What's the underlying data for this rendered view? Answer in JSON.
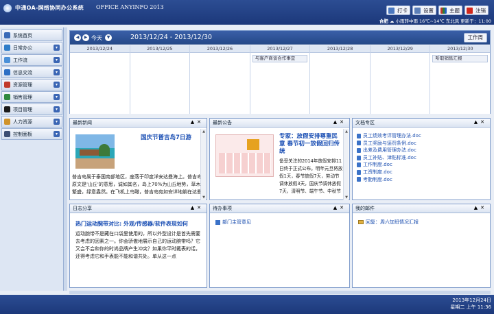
{
  "app": {
    "title": "中通OA-网络协同办公系统",
    "subtitle": "OFFICE ANYINFO 2013"
  },
  "toolbar": {
    "buttons": [
      {
        "label": "打卡",
        "icon": "clock-icon",
        "color": "#4b78c0"
      },
      {
        "label": "设置",
        "icon": "gear-icon",
        "color": "#5c7fb8"
      },
      {
        "label": "主题",
        "icon": "theme-icon",
        "color": "#c0392b"
      },
      {
        "label": "注销",
        "icon": "logout-icon",
        "color": "#d0281c"
      }
    ]
  },
  "weather": {
    "city": "合肥",
    "text": "小雨转中雨 16℃~14℃ 东北风 更新于：11:00"
  },
  "sidebar": {
    "items": [
      {
        "label": "系统首页",
        "icon": "home-icon",
        "color": "#3a6bb8",
        "has_menu": false
      },
      {
        "label": "日常办公",
        "icon": "calendar-icon",
        "color": "#2e7dc9",
        "has_menu": true
      },
      {
        "label": "工作流",
        "icon": "workflow-icon",
        "color": "#4a90d8",
        "has_menu": true
      },
      {
        "label": "信息交流",
        "icon": "chat-icon",
        "color": "#2c6fc4",
        "has_menu": true
      },
      {
        "label": "资源管理",
        "icon": "folder-icon",
        "color": "#c13a2b",
        "has_menu": true
      },
      {
        "label": "销售管理",
        "icon": "sales-icon",
        "color": "#2f8a3f",
        "has_menu": true
      },
      {
        "label": "项目管理",
        "icon": "project-icon",
        "color": "#1b1b1b",
        "has_menu": true
      },
      {
        "label": "人力资源",
        "icon": "people-icon",
        "color": "#d0932a",
        "has_menu": true
      },
      {
        "label": "控制面板",
        "icon": "control-panel-icon",
        "color": "#3d4f73",
        "has_menu": true
      }
    ]
  },
  "calendar": {
    "today_label": "今天",
    "range": "2013/12/24 - 2013/12/30",
    "view_button": "工作周",
    "days": [
      {
        "date": "2013/12/24",
        "event": ""
      },
      {
        "date": "2013/12/25",
        "event": ""
      },
      {
        "date": "2013/12/26",
        "event": ""
      },
      {
        "date": "2013/12/27",
        "event": "与客户商谈合作事宜"
      },
      {
        "date": "2013/12/28",
        "event": ""
      },
      {
        "date": "2013/12/29",
        "event": ""
      },
      {
        "date": "2013/12/30",
        "event": "听取销售汇报"
      }
    ]
  },
  "panels": {
    "news": {
      "title": "最新新闻",
      "headline": "国庆节普吉岛7日游",
      "body": "普吉岛属于泰国南部地区，座落于印度洋安达曼海上。普吉岛原文是'山丘'的意思，诚如其名，岛上70%为山丘地势，草木繁盛，绿意盎然。在飞机上鸟瞰，普吉岛宛如安详地躺在达曼海上的一颗'绿色珍珠'，全岛南北纵..."
    },
    "notice": {
      "title": "最新公告",
      "headline": "专家：放假安排尊重民意 春节初一放假回归传统",
      "body": "备受关注的2014年放假安排11日终于正式公布。明年元旦将放假1天，春节放假7天，劳动节调休放假3天，国庆节调休放假7天，清明节、端午节、中秋节各放假1天。但因休假与周末连休而形成了3天小长假。"
    },
    "docs": {
      "title": "文档专区",
      "items": [
        "员工绩效考评管理办法.doc",
        "员工奖励与惩罚条例.doc",
        "出差及费用管理办法.doc",
        "员工补贴、津贴标准.doc",
        "工作制度.doc",
        "工资制度.doc",
        "考勤制度.doc"
      ]
    },
    "blog": {
      "title": "日志分享",
      "headline": "热门运动腕带对比: 外观/传感器/软件表现如何",
      "body": "运动腕带不是藏在口袋里使用的，所以外型设计是首先需要去考虑的因素之一。你会骄傲地展示自己的运动腕带吗？它又会不会和你的时尚品牌产生冲突？如果你平时戴表的话，还得考虑它和手表能不能和谐共处。单从这一点"
    },
    "todo": {
      "title": "待办事项",
      "items": [
        "部门主管意见"
      ]
    },
    "mail": {
      "title": "我的邮件",
      "items": [
        "回复：周六加班情况汇报"
      ]
    }
  },
  "status": {
    "date": "2013年12月24日",
    "time": "星期二 上午 11:36"
  }
}
